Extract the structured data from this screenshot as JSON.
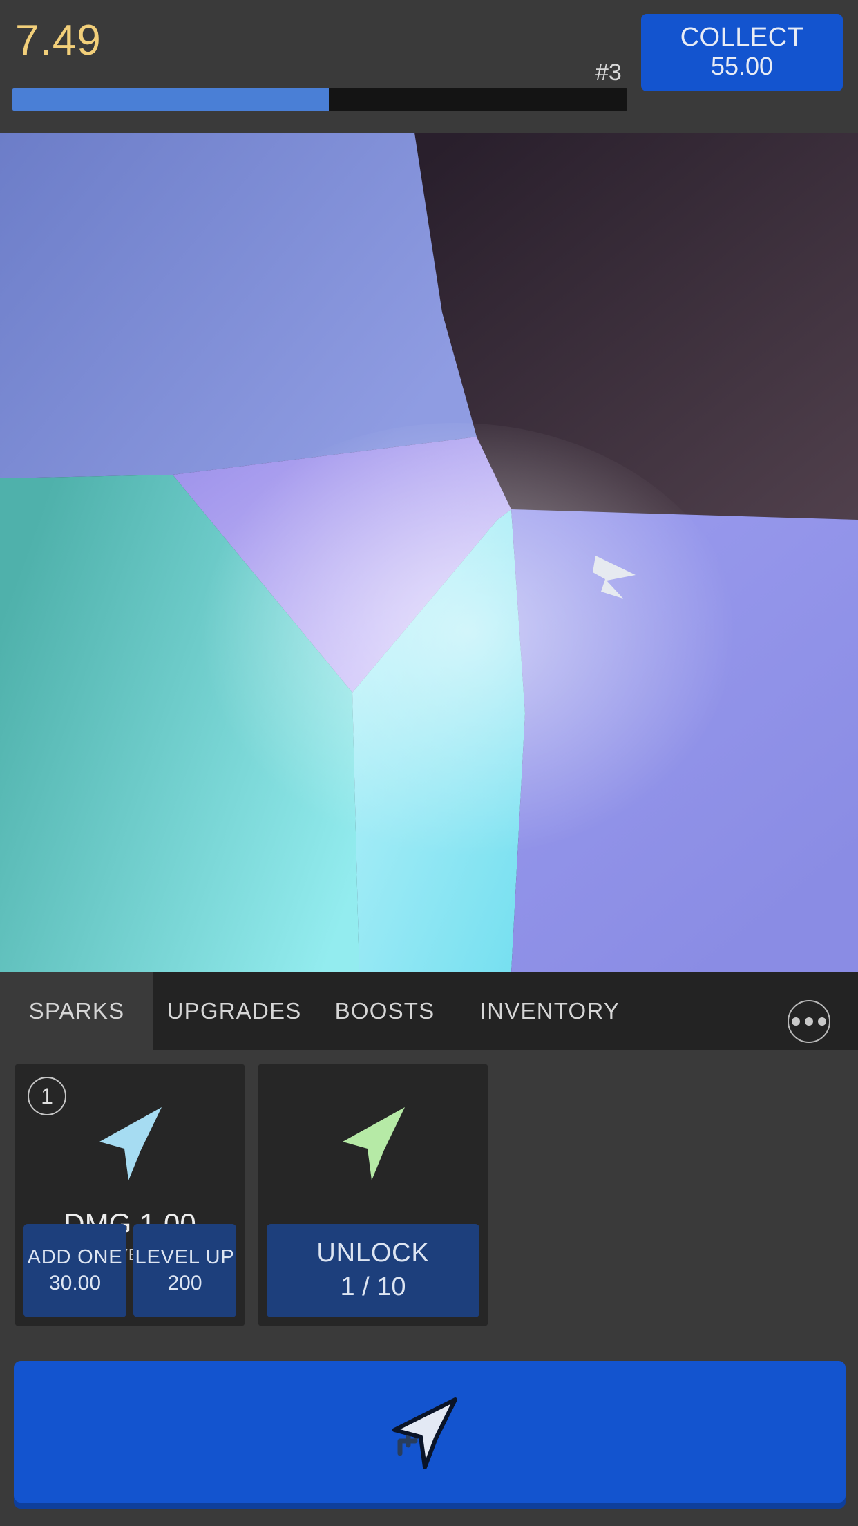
{
  "header": {
    "score": "7.49",
    "rank": "#3",
    "collect_label": "COLLECT",
    "collect_value": "55.00",
    "progress_percent": 51.5,
    "progress_fill_color": "#4a7fd6",
    "progress_track_color": "#141414",
    "score_color": "#f2cf7a",
    "accent_color": "#1354cf"
  },
  "game": {
    "cursor_icon": "arrow-cursor-right",
    "cursor_color": "#e6eaf0",
    "facets": [
      {
        "name": "upper-left-blue",
        "color_from": "#6d7ec9",
        "color_to": "#8d9ae0"
      },
      {
        "name": "upper-right-dark",
        "color_from": "#2a212d",
        "color_to": "#4a3a46"
      },
      {
        "name": "center-lavender",
        "color_from": "#a79cf0",
        "color_to": "#cfc3fb"
      },
      {
        "name": "left-teal",
        "color_from": "#52b4ae",
        "color_to": "#8ee9ee"
      },
      {
        "name": "center-cyan",
        "color_from": "#77e6f2",
        "color_to": "#b4f0f7"
      },
      {
        "name": "right-periwinkle",
        "color_from": "#8d8fe6",
        "color_to": "#a9a6f2"
      }
    ]
  },
  "tabs": [
    {
      "key": "sparks",
      "label": "SPARKS",
      "active": true
    },
    {
      "key": "upgrades",
      "label": "UPGRADES",
      "active": false
    },
    {
      "key": "boosts",
      "label": "BOOSTS",
      "active": false
    },
    {
      "key": "inventory",
      "label": "INVENTORY",
      "active": false
    }
  ],
  "more_menu": {
    "icon": "more-horizontal-icon"
  },
  "cards": [
    {
      "badge": "1",
      "art_icon": "arrow-spark-light-blue",
      "art_color": "#a6dcf2",
      "stat_label": "DMG 1.00",
      "level_label": "LEVEL 0",
      "actions": [
        {
          "key": "add-one",
          "title": "ADD ONE",
          "sub": "30.00"
        },
        {
          "key": "level-up",
          "title": "LEVEL UP",
          "sub": "200"
        }
      ]
    },
    {
      "badge": "",
      "art_icon": "arrow-spark-light-green",
      "art_color": "#b6eaa6",
      "stat_label": "",
      "level_label": "",
      "actions": [
        {
          "key": "unlock",
          "title": "UNLOCK",
          "sub": "1 / 10"
        }
      ]
    }
  ],
  "click_button": {
    "icon": "cursor-click-icon",
    "color": "#1354cf",
    "shadow_color": "#0e3f9c"
  }
}
